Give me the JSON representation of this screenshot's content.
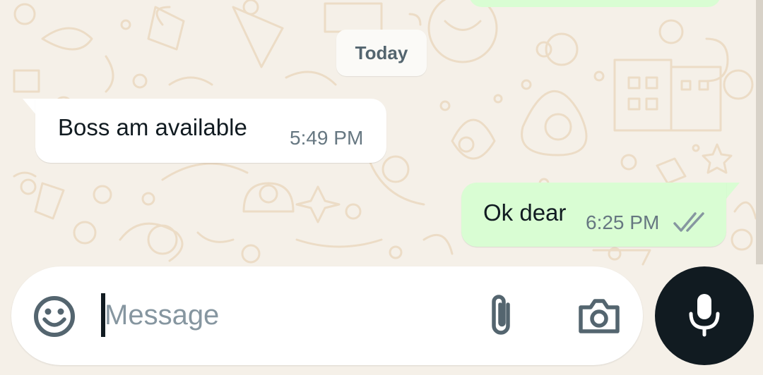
{
  "chat": {
    "date_separator": "Today",
    "messages": [
      {
        "direction": "incoming",
        "text": "Boss am available",
        "time": "5:49 PM"
      },
      {
        "direction": "outgoing",
        "text": "Ok dear",
        "time": "6:25 PM",
        "status": "read"
      }
    ]
  },
  "composer": {
    "placeholder": "Message",
    "value": "",
    "icons": {
      "emoji": "emoji-icon",
      "attach": "paperclip-icon",
      "camera": "camera-icon",
      "mic": "microphone-icon"
    }
  },
  "colors": {
    "wallpaper": "#f5f0e8",
    "doodle": "#ecdcc6",
    "incoming_bubble": "#ffffff",
    "outgoing_bubble": "#d9fdd3",
    "mic_button": "#111b21",
    "read_ticks": "#8696a0",
    "timestamp": "#667781"
  }
}
